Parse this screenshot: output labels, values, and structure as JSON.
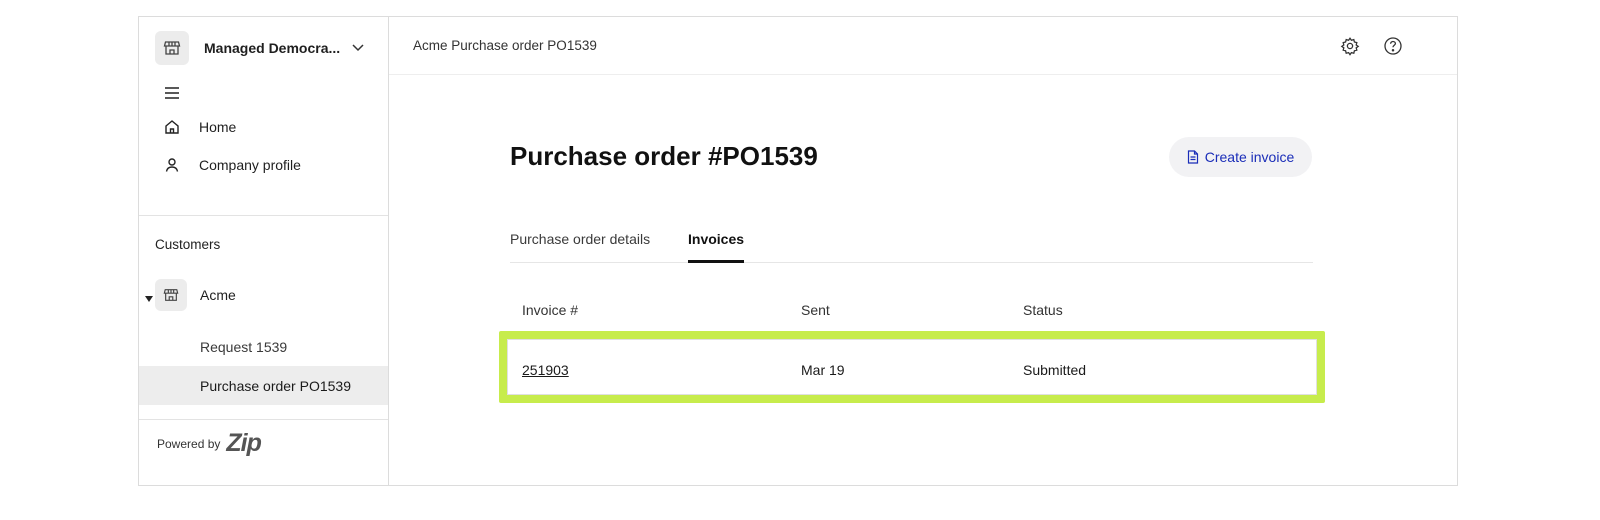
{
  "sidebar": {
    "org_name": "Managed Democra...",
    "nav": [
      {
        "label": "Home",
        "icon": "home-icon"
      },
      {
        "label": "Company profile",
        "icon": "user-icon"
      }
    ],
    "section_label": "Customers",
    "customer": {
      "label": "Acme",
      "icon": "store-icon"
    },
    "sub_items": [
      {
        "label": "Request 1539",
        "active": false
      },
      {
        "label": "Purchase order PO1539",
        "active": true
      }
    ],
    "powered_by": "Powered by",
    "brand": "Zip"
  },
  "topbar": {
    "breadcrumb": "Acme Purchase order PO1539",
    "icons": [
      "gear-icon",
      "help-icon"
    ]
  },
  "main": {
    "title": "Purchase order #PO1539",
    "create_button": "Create invoice",
    "tabs": [
      {
        "label": "Purchase order details",
        "active": false
      },
      {
        "label": "Invoices",
        "active": true
      }
    ],
    "table": {
      "headers": [
        "Invoice #",
        "Sent",
        "Status"
      ],
      "rows": [
        {
          "invoice": "251903",
          "sent": "Mar 19",
          "status": "Submitted"
        }
      ]
    }
  },
  "colors": {
    "accent": "#1a2db8",
    "highlight": "#c7ec4c",
    "active_bg": "#ededed"
  }
}
